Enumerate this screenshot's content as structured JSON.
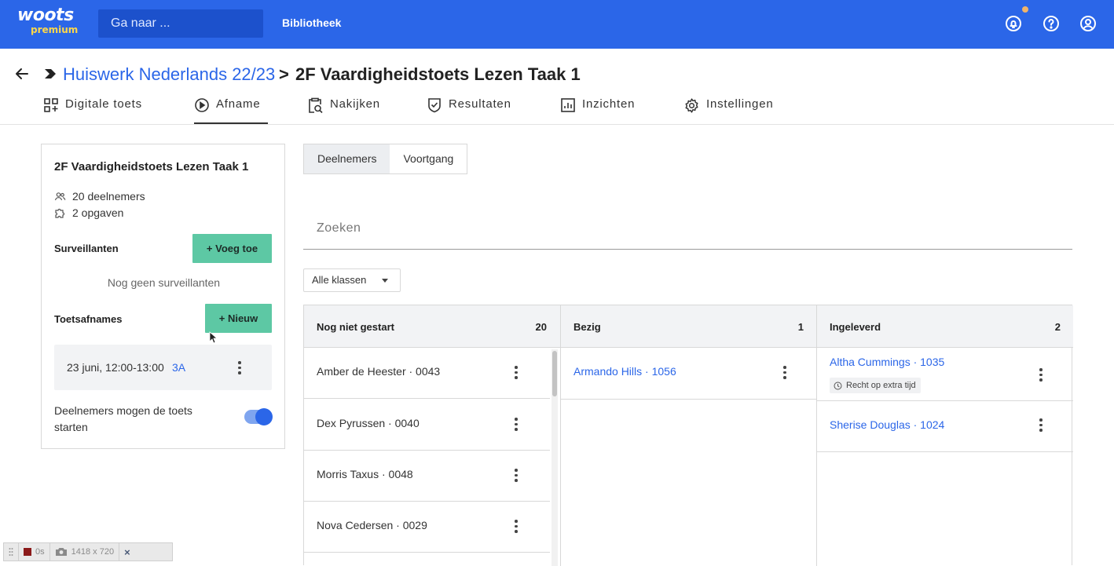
{
  "app": {
    "logo_text": "woots",
    "logo_tier": "premium",
    "search_placeholder": "Ga naar ...",
    "nav_library": "Bibliotheek",
    "icons": [
      "notifications-icon",
      "help-icon",
      "account-icon"
    ]
  },
  "breadcrumb": {
    "parent": "Huiswerk Nederlands 22/23",
    "separator": ">",
    "current": "2F Vaardigheidstoets Lezen Taak 1"
  },
  "tabs": [
    {
      "label": "Digitale toets",
      "icon": "digital-test-icon"
    },
    {
      "label": "Afname",
      "icon": "play-circle-icon",
      "active": true
    },
    {
      "label": "Nakijken",
      "icon": "clipboard-search-icon"
    },
    {
      "label": "Resultaten",
      "icon": "shield-check-icon"
    },
    {
      "label": "Inzichten",
      "icon": "bar-chart-icon"
    },
    {
      "label": "Instellingen",
      "icon": "gear-icon"
    }
  ],
  "summary": {
    "title": "2F Vaardigheidstoets Lezen Taak 1",
    "participants": "20 deelnemers",
    "questions": "2 opgaven",
    "supervisors_label": "Surveillanten",
    "add_supervisor_button": "+ Voeg toe",
    "no_supervisors": "Nog geen surveillanten",
    "sessions_label": "Toetsafnames",
    "new_session_button": "+ Nieuw",
    "session": {
      "time": "23 juni, 12:00-13:00",
      "class": "3A"
    },
    "toggle_label": "Deelnemers mogen de toets starten",
    "toggle_on": true
  },
  "view_tabs": [
    "Deelnemers",
    "Voortgang"
  ],
  "search_placeholder": "Zoeken",
  "filter": {
    "selected": "Alle klassen"
  },
  "columns": [
    {
      "title": "Nog niet gestart",
      "count": "20",
      "items": [
        {
          "name": "Amber de Heester · 0043"
        },
        {
          "name": "Dex Pyrussen · 0040"
        },
        {
          "name": "Morris Taxus · 0048"
        },
        {
          "name": "Nova Cedersen · 0029"
        }
      ]
    },
    {
      "title": "Bezig",
      "count": "1",
      "items": [
        {
          "name": "Armando Hills · 1056"
        }
      ]
    },
    {
      "title": "Ingeleverd",
      "count": "2",
      "items": [
        {
          "name": "Altha Cummings · 1035",
          "badge": "Recht op extra tijd"
        },
        {
          "name": "Sherise Douglas · 1024"
        }
      ]
    }
  ],
  "recorder": {
    "time": "0s",
    "size": "1418 x 720",
    "close": "×"
  },
  "colors": {
    "primary": "#2b66e8",
    "accent_green": "#5dc8a4",
    "tier_yellow": "#ffd84a"
  }
}
